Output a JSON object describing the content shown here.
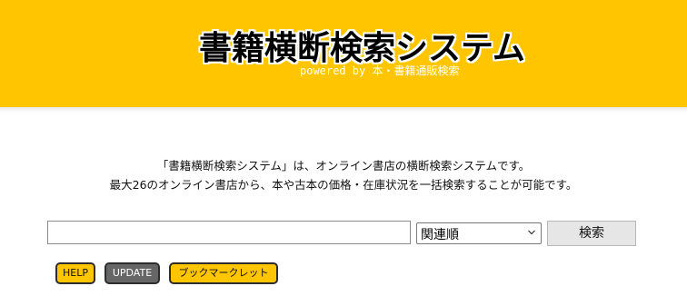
{
  "header": {
    "logo": "書籍横断検索システム",
    "powered": "powered by 本・書籍通販検索",
    "background": "#ffc600"
  },
  "intro": {
    "line1": "「書籍横断検索システム」は、オンライン書店の横断検索システムです。",
    "line2": "最大26のオンライン書店から、本や古本の価格・在庫状況を一括検索することが可能です。"
  },
  "search": {
    "value": "",
    "placeholder": "",
    "sort_selected": "関連順",
    "button": "検索"
  },
  "links": {
    "help": "HELP",
    "update": "UPDATE",
    "bookmarklet": "ブックマークレット"
  },
  "icons": {
    "sort_dropdown": "chevron-down-icon"
  }
}
